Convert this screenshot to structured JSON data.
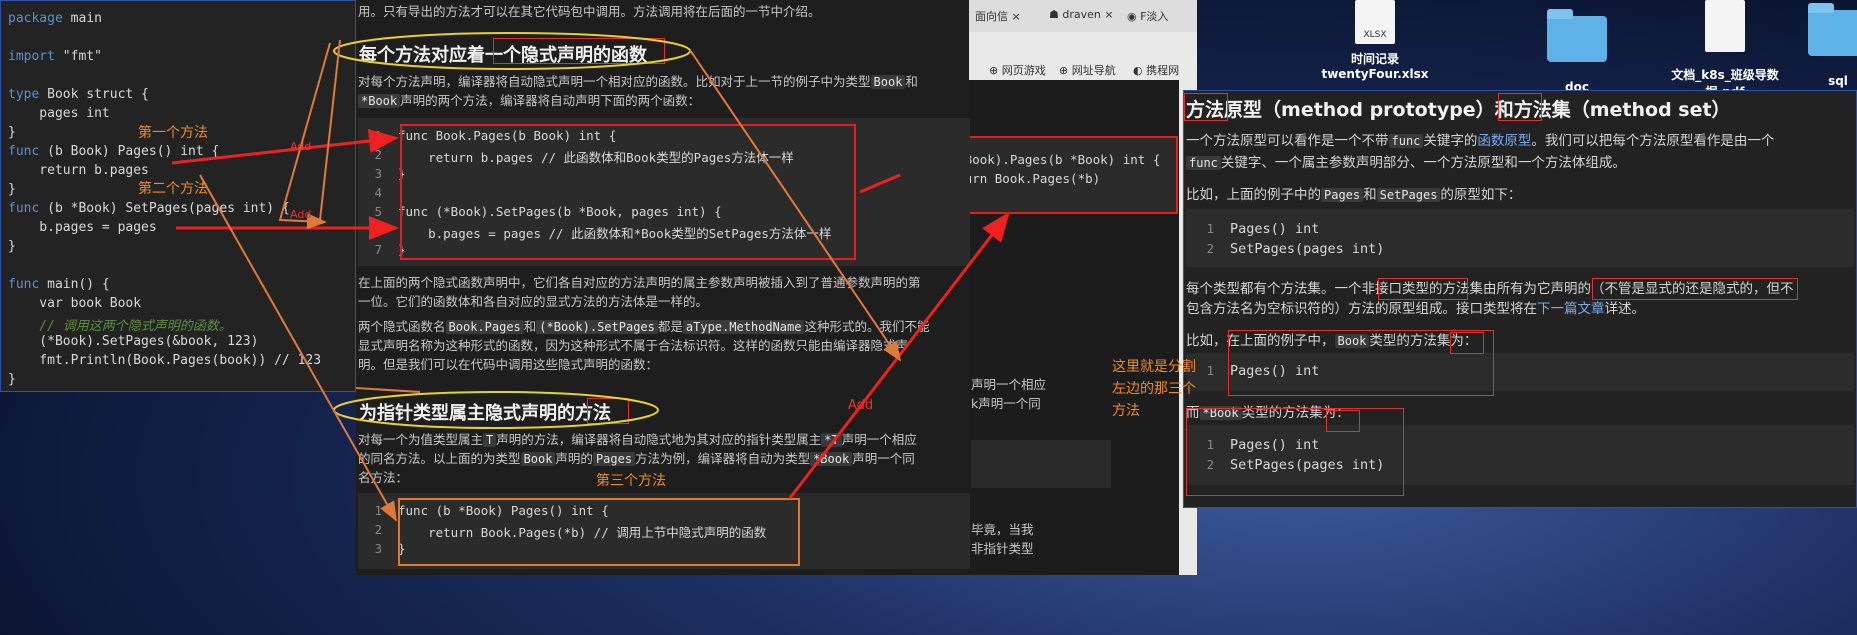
{
  "editor": {
    "lines": [
      {
        "k": "package",
        "r": " main"
      },
      {
        "k": "",
        "r": ""
      },
      {
        "k": "import",
        "r": " \"fmt\""
      },
      {
        "k": "",
        "r": ""
      },
      {
        "k": "type",
        "r": " Book struct {"
      },
      {
        "k": "",
        "r": "    pages int"
      },
      {
        "k": "",
        "r": "}"
      },
      {
        "k": "func",
        "r": " (b Book) Pages() int {"
      },
      {
        "k": "",
        "r": "    return b.pages"
      },
      {
        "k": "",
        "r": "}"
      },
      {
        "k": "func",
        "r": " (b *Book) SetPages(pages int) {"
      },
      {
        "k": "",
        "r": "    b.pages = pages"
      },
      {
        "k": "",
        "r": "}"
      },
      {
        "k": "",
        "r": ""
      },
      {
        "k": "func",
        "r": " main() {"
      },
      {
        "k": "",
        "r": "    var book Book"
      },
      {
        "k": "",
        "r": "    // 调用这两个隐式声明的函数。",
        "c": true
      },
      {
        "k": "",
        "r": "    (*Book).SetPages(&book, 123)"
      },
      {
        "k": "",
        "r": "    fmt.Println(Book.Pages(book)) // 123"
      },
      {
        "k": "",
        "r": "}"
      }
    ]
  },
  "annotations": {
    "first_method": "第一个方法",
    "second_method": "第二个方法",
    "third_method": "第三个方法",
    "add1": "Add",
    "add2": "Add",
    "add3": "Add",
    "split_note_1": "这里就是分割",
    "split_note_2": "左边的那三个",
    "split_note_3": "方法"
  },
  "article": {
    "top_line": "用。只有导出的方法才可以在其它代码包中调用。方法调用将在后面的一节中介绍。",
    "h1": "每个方法对应着一个隐式声明的函数",
    "p1a": "对每个方法声明，编译器将自动隐式声明一个相对应的函数。比如对于上一节的例子中为类型",
    "p1b": "Book",
    "p1c": "和",
    "p1d": "*Book",
    "p1e": "声明的两个方法，编译器将自动声明下面的两个函数：",
    "code1": [
      {
        "n": "1",
        "t": "func Book.Pages(b Book) int {"
      },
      {
        "n": "2",
        "t": "    return b.pages // 此函数体和Book类型的Pages方法体一样"
      },
      {
        "n": "3",
        "t": "}"
      },
      {
        "n": "4",
        "t": ""
      },
      {
        "n": "5",
        "t": "func (*Book).SetPages(b *Book, pages int) {"
      },
      {
        "n": "6",
        "t": "    b.pages = pages // 此函数体和*Book类型的SetPages方法体一样"
      },
      {
        "n": "7",
        "t": "}"
      }
    ],
    "p2a": "在上面的两个隐式函数声明中，它们各自对应的方法声明的属主参数声明被插入到了普通参数声明的第",
    "p2b": "一位。它们的函数体和各自对应的显式方法的方法体是一样的。",
    "p3a": "两个隐式函数名",
    "p3b": "Book.Pages",
    "p3c": "和",
    "p3d": "(*Book).SetPages",
    "p3e": "都是",
    "p3f": "aType.MethodName",
    "p3g": "这种形式的。我们不能",
    "p3h": "显式声明名称为这种形式的函数，因为这种形式不属于合法标识符。这样的函数只能由编译器隐式声",
    "p3i": "明。但是我们可以在代码中调用这些隐式声明的函数：",
    "h2": "为指针类型属主隐式声明的方法",
    "p4a": "对每一个为值类型属主",
    "p4b": "T",
    "p4c": "声明的方法，编译器将自动隐式地为其对应的指针类型属主",
    "p4d": "*T",
    "p4e": "声明一个相应",
    "p4f": "的同名方法。以上面的为类型",
    "p4g": "Book",
    "p4h": "声明的",
    "p4i": "Pages",
    "p4j": "方法为例，编译器将自动为类型",
    "p4k": "*Book",
    "p4l": "声明一个同",
    "p4m": "名方法：",
    "code2": [
      {
        "n": "1",
        "t": "func (b *Book) Pages() int {"
      },
      {
        "n": "2",
        "t": "    return Book.Pages(*b) // 调用上节中隐式声明的函数"
      },
      {
        "n": "3",
        "t": "}"
      }
    ]
  },
  "browser": {
    "tabs": [
      "面向信",
      "draven",
      "F淡入"
    ],
    "bookmarks": [
      "网页游戏",
      "网址导航",
      "携程网"
    ],
    "partial1": "声明一个相应",
    "partial2": "k声明一个同",
    "partial3": "毕竟，当我",
    "partial4": "非指针类型",
    "code_popup_1": "func (*Book).Pages(b *Book) int {",
    "code_popup_2": "    return Book.Pages(*b)",
    "code_popup_3": "}"
  },
  "right": {
    "title_a": "方法",
    "title_b": "原型（method prototype）和",
    "title_c": "方法",
    "title_d": "集（method set）",
    "r1a": "一个方法原型可以看作是一个不带",
    "r1b": "func",
    "r1c": "关键字的",
    "r1d": "函数原型",
    "r1e": "。我们可以把每个方法原型看作是由一个",
    "r2a": "func",
    "r2b": "关键字、一个属主参数声明部分、一个方法原型和一个方法体组成。",
    "r3a": "比如，上面的例子中的",
    "r3b": "Pages",
    "r3c": "和",
    "r3d": "SetPages",
    "r3e": "的原型如下：",
    "code1": [
      {
        "n": "1",
        "t": "Pages() int"
      },
      {
        "n": "2",
        "t": "SetPages(pages int)"
      }
    ],
    "r4a": "每个类型都有个方法集。一个",
    "r4b": "非接口类型",
    "r4c": "的方法集由所有为它声明的（",
    "r4d": "不管是显式的还是隐式",
    "r4e": "的，但不",
    "r5": "包含方法名为空标识符的）方法的原型组成。接口类型将在",
    "r5b": "下一篇文章",
    "r5c": "详述。",
    "r6a": "比如，",
    "r6b": "在上面的例子中，",
    "r6c": "Book",
    "r6d": "类型的",
    "r6e": "方法",
    "r6f": "集为：",
    "code2": [
      {
        "n": "1",
        "t": "Pages() int"
      }
    ],
    "r7a": "而",
    "r7b": "*Book",
    "r7c": "类型的",
    "r7d": "方法",
    "r7e": "集为：",
    "code3": [
      {
        "n": "1",
        "t": "Pages() int"
      },
      {
        "n": "2",
        "t": "SetPages(pages int)"
      }
    ]
  },
  "desktop": {
    "xlsx_name_1": "时间记录",
    "xlsx_name_2": "twentyFour.xlsx",
    "xlsx_tag": "XLSX",
    "folder1": "doc",
    "pdf_name_1": "文档_k8s_班级导数",
    "pdf_name_2": "据.pdf",
    "folder2": "sql"
  }
}
